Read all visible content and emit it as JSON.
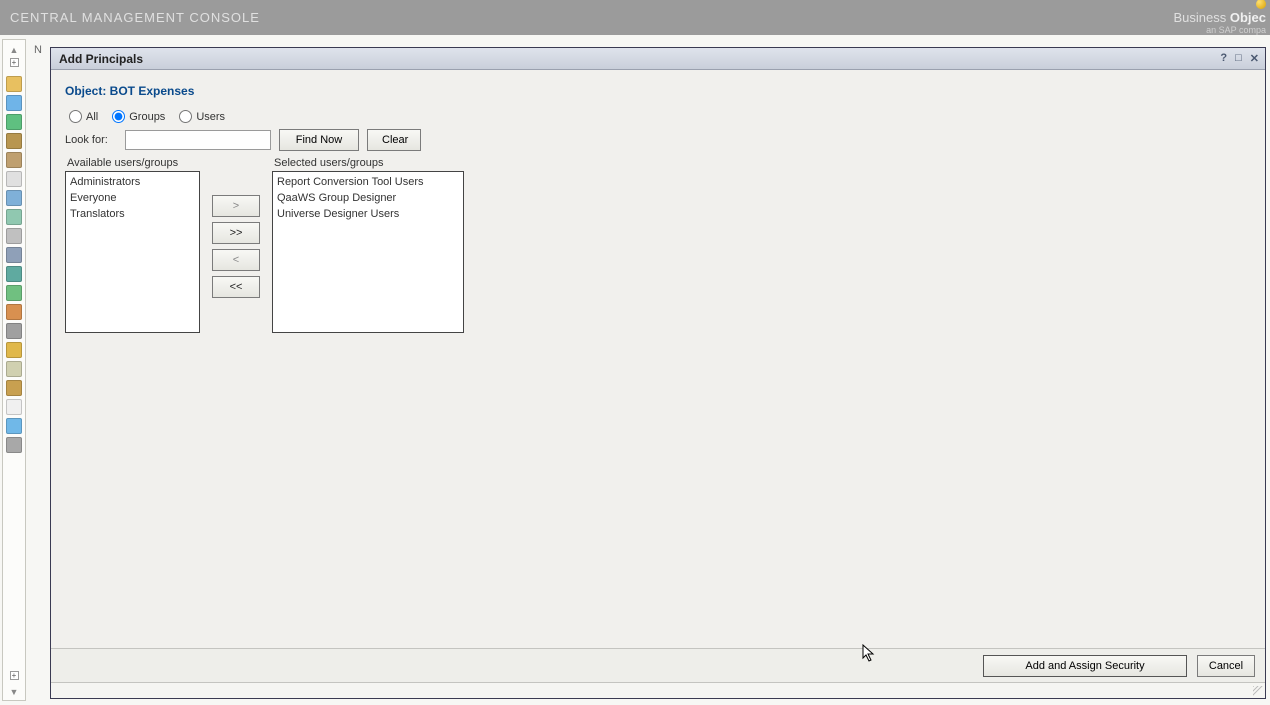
{
  "app": {
    "title": "CENTRAL MANAGEMENT CONSOLE",
    "brand_main_a": "Business",
    "brand_main_b": "Objec",
    "brand_sub": "an SAP compa"
  },
  "dialog": {
    "title": "Add Principals",
    "object_label": "Object: BOT Expenses",
    "radios": {
      "all": "All",
      "groups": "Groups",
      "users": "Users"
    },
    "look_for_label": "Look for:",
    "look_for_value": "",
    "find_now": "Find Now",
    "clear": "Clear",
    "available_header": "Available users/groups",
    "selected_header": "Selected users/groups",
    "available": [
      "Administrators",
      "Everyone",
      "Translators"
    ],
    "selected": [
      "Report Conversion Tool Users",
      "QaaWS Group Designer",
      "Universe Designer Users"
    ],
    "transfer": {
      "add": ">",
      "add_all": ">>",
      "remove": "<",
      "remove_all": "<<"
    },
    "footer": {
      "primary": "Add and Assign Security",
      "cancel": "Cancel"
    },
    "controls": {
      "help": "?",
      "max": "□",
      "close": "✕"
    }
  },
  "sidebar_icons": [
    "#e8c060",
    "#6fb4e8",
    "#5fc080",
    "#b89650",
    "#bfa070",
    "#e0e0e0",
    "#7fb0d8",
    "#90c8b0",
    "#c0c0c0",
    "#8fa0b8",
    "#5faaa0",
    "#70c080",
    "#d89050",
    "#a0a0a0",
    "#e0b84a",
    "#d0d0b0",
    "#c8a050",
    "#f0f0f0",
    "#70b8e8",
    "#a8a8a8"
  ]
}
